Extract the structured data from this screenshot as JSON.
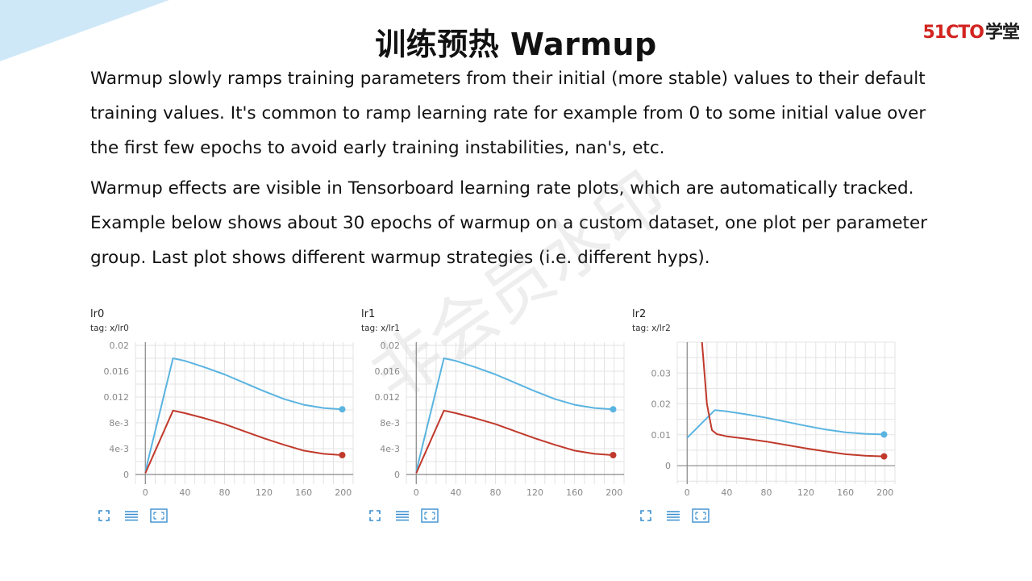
{
  "slide": {
    "title": "训练预热 Warmup",
    "logo_brand": "51CTO",
    "logo_cn": "学堂",
    "paragraph1": "Warmup slowly ramps training parameters from their initial (more stable) values to their default training values. It's common to ramp learning rate for example from 0 to some initial value over the first few epochs to avoid early training instabilities, nan's, etc.",
    "paragraph2": "Warmup effects are visible in Tensorboard learning rate plots, which are automatically tracked. Example below shows about 30 epochs of warmup on a custom dataset, one plot per parameter group. Last plot shows different warmup strategies (i.e. different hyps).",
    "watermark": "非会员水印"
  },
  "colors": {
    "accent_blue": "#5ab4e0",
    "accent_red": "#c0392b",
    "corner_wedge": "#cfe8f8",
    "icon_blue": "#3a8fd0"
  },
  "tool_icons": [
    "fullscreen-icon",
    "list-icon",
    "fit-domain-icon"
  ],
  "chart_data": [
    {
      "type": "line",
      "title": "lr0",
      "subtitle": "tag: x/lr0",
      "xlim": [
        -10,
        210
      ],
      "ylim": [
        -0.0015,
        0.0205
      ],
      "xticks": [
        0,
        40,
        80,
        120,
        160,
        200
      ],
      "yticks": [
        0,
        0.004,
        0.008,
        0.012,
        0.016,
        0.02
      ],
      "yticklabels": [
        "0",
        "4e-3",
        "8e-3",
        "0.012",
        "0.016",
        "0.02"
      ],
      "series": [
        {
          "color": "#5ab4e0",
          "x": [
            0,
            28,
            40,
            60,
            80,
            100,
            120,
            140,
            160,
            180,
            199
          ],
          "y": [
            0.0005,
            0.018,
            0.0176,
            0.0166,
            0.0155,
            0.0142,
            0.0129,
            0.0117,
            0.0108,
            0.0103,
            0.0101
          ]
        },
        {
          "color": "#c0392b",
          "x": [
            0,
            28,
            40,
            60,
            80,
            100,
            120,
            140,
            160,
            180,
            199
          ],
          "y": [
            0.0002,
            0.0099,
            0.0095,
            0.0087,
            0.0078,
            0.0067,
            0.0056,
            0.0046,
            0.0037,
            0.0032,
            0.003
          ]
        }
      ]
    },
    {
      "type": "line",
      "title": "lr1",
      "subtitle": "tag: x/lr1",
      "xlim": [
        -10,
        210
      ],
      "ylim": [
        -0.0015,
        0.0205
      ],
      "xticks": [
        0,
        40,
        80,
        120,
        160,
        200
      ],
      "yticks": [
        0,
        0.004,
        0.008,
        0.012,
        0.016,
        0.02
      ],
      "yticklabels": [
        "0",
        "4e-3",
        "8e-3",
        "0.012",
        "0.016",
        "0.02"
      ],
      "series": [
        {
          "color": "#5ab4e0",
          "x": [
            0,
            28,
            40,
            60,
            80,
            100,
            120,
            140,
            160,
            180,
            199
          ],
          "y": [
            0.0005,
            0.018,
            0.0176,
            0.0166,
            0.0155,
            0.0142,
            0.0129,
            0.0117,
            0.0108,
            0.0103,
            0.0101
          ]
        },
        {
          "color": "#c0392b",
          "x": [
            0,
            28,
            40,
            60,
            80,
            100,
            120,
            140,
            160,
            180,
            199
          ],
          "y": [
            0.0002,
            0.0099,
            0.0095,
            0.0087,
            0.0078,
            0.0067,
            0.0056,
            0.0046,
            0.0037,
            0.0032,
            0.003
          ]
        }
      ]
    },
    {
      "type": "line",
      "title": "lr2",
      "subtitle": "tag: x/lr2",
      "xlim": [
        -10,
        210
      ],
      "ylim": [
        -0.006,
        0.04
      ],
      "xticks": [
        0,
        40,
        80,
        120,
        160,
        200
      ],
      "yticks": [
        0,
        0.01,
        0.02,
        0.03
      ],
      "yticklabels": [
        "0",
        "0.01",
        "0.02",
        "0.03"
      ],
      "series": [
        {
          "color": "#5ab4e0",
          "x": [
            0,
            28,
            40,
            60,
            80,
            100,
            120,
            140,
            160,
            180,
            199
          ],
          "y": [
            0.009,
            0.018,
            0.0176,
            0.0166,
            0.0155,
            0.0142,
            0.0129,
            0.0117,
            0.0108,
            0.0103,
            0.0101
          ]
        },
        {
          "color": "#c0392b",
          "x": [
            15,
            20,
            25,
            30,
            40,
            60,
            80,
            100,
            120,
            140,
            160,
            180,
            199
          ],
          "y": [
            0.04,
            0.02,
            0.0115,
            0.0102,
            0.0095,
            0.0087,
            0.0078,
            0.0067,
            0.0056,
            0.0046,
            0.0037,
            0.0032,
            0.003
          ]
        }
      ]
    }
  ]
}
